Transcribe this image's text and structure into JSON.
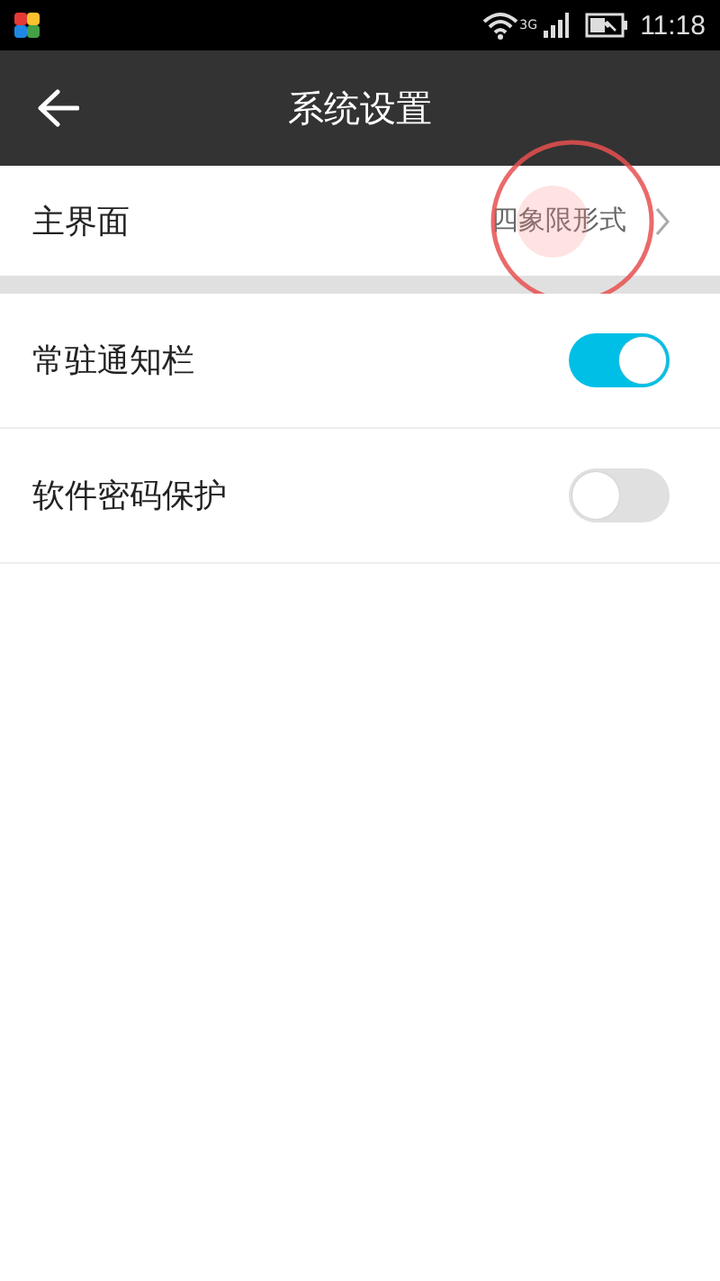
{
  "status_bar": {
    "network": "3G",
    "time": "11:18"
  },
  "header": {
    "title": "系统设置"
  },
  "main_row": {
    "label": "主界面",
    "value": "四象限形式"
  },
  "toggles": [
    {
      "label": "常驻通知栏",
      "on": true
    },
    {
      "label": "软件密码保护",
      "on": false
    }
  ]
}
